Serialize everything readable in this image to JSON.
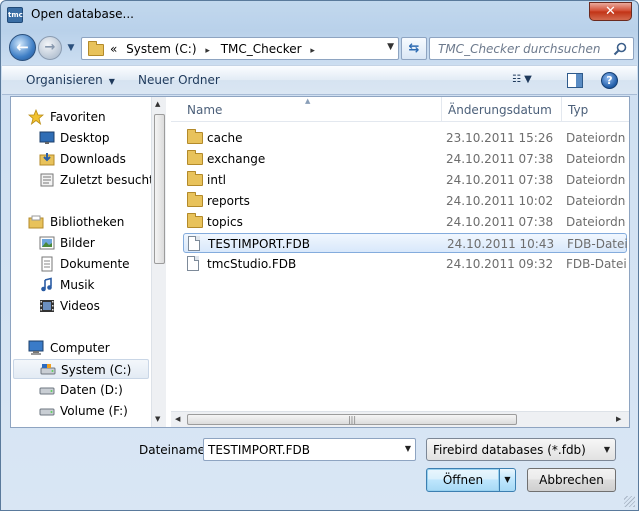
{
  "window": {
    "title": "Open database...",
    "app_icon_text": "tmc",
    "close_glyph": "✕"
  },
  "navigation": {
    "back_glyph": "←",
    "forward_glyph": "→",
    "history_glyph": "▼",
    "address_prefix": "«",
    "breadcrumbs": [
      "System (C:)",
      "TMC_Checker"
    ],
    "crumb_separator": "▸",
    "refresh_glyph": "⇆",
    "search_placeholder": "TMC_Checker durchsuchen"
  },
  "toolbar": {
    "organize_label": "Organisieren",
    "organize_caret": "▼",
    "new_folder_label": "Neuer Ordner",
    "view_glyph": "☷ ▼",
    "help_glyph": "?"
  },
  "nav_pane": {
    "groups": [
      {
        "label": "Favoriten",
        "icon": "star-icon",
        "items": [
          {
            "label": "Desktop",
            "icon": "desktop-icon"
          },
          {
            "label": "Downloads",
            "icon": "downloads-icon"
          },
          {
            "label": "Zuletzt besucht",
            "icon": "recent-places-icon"
          }
        ]
      },
      {
        "label": "Bibliotheken",
        "icon": "libraries-icon",
        "items": [
          {
            "label": "Bilder",
            "icon": "pictures-icon"
          },
          {
            "label": "Dokumente",
            "icon": "documents-icon"
          },
          {
            "label": "Musik",
            "icon": "music-icon"
          },
          {
            "label": "Videos",
            "icon": "videos-icon"
          }
        ]
      },
      {
        "label": "Computer",
        "icon": "computer-icon",
        "items": [
          {
            "label": "System (C:)",
            "icon": "drive-icon",
            "selected": true
          },
          {
            "label": "Daten (D:)",
            "icon": "drive-icon"
          },
          {
            "label": "Volume (F:)",
            "icon": "drive-icon"
          }
        ]
      }
    ]
  },
  "file_list": {
    "columns": {
      "name": "Name",
      "date": "Änderungsdatum",
      "type": "Typ"
    },
    "sort_glyph": "▲",
    "rows": [
      {
        "name": "cache",
        "date": "23.10.2011 15:26",
        "type": "Dateiordner",
        "kind": "folder"
      },
      {
        "name": "exchange",
        "date": "24.10.2011 07:38",
        "type": "Dateiordner",
        "kind": "folder"
      },
      {
        "name": "intl",
        "date": "24.10.2011 07:38",
        "type": "Dateiordner",
        "kind": "folder"
      },
      {
        "name": "reports",
        "date": "24.10.2011 10:02",
        "type": "Dateiordner",
        "kind": "folder"
      },
      {
        "name": "topics",
        "date": "24.10.2011 07:38",
        "type": "Dateiordner",
        "kind": "folder"
      },
      {
        "name": "TESTIMPORT.FDB",
        "date": "24.10.2011 10:43",
        "type": "FDB-Datei",
        "kind": "file",
        "selected": true
      },
      {
        "name": "tmcStudio.FDB",
        "date": "24.10.2011 09:32",
        "type": "FDB-Datei",
        "kind": "file"
      }
    ],
    "scroll_grip": "|||"
  },
  "bottom": {
    "filename_label": "Dateiname:",
    "filename_value": "TESTIMPORT.FDB",
    "filter_value": "Firebird databases (*.fdb)",
    "dropdown_glyph": "▼",
    "open_label": "Öffnen",
    "cancel_label": "Abbrechen"
  },
  "colors": {
    "selection_border": "#84acdd",
    "accent": "#3c7fb1"
  }
}
